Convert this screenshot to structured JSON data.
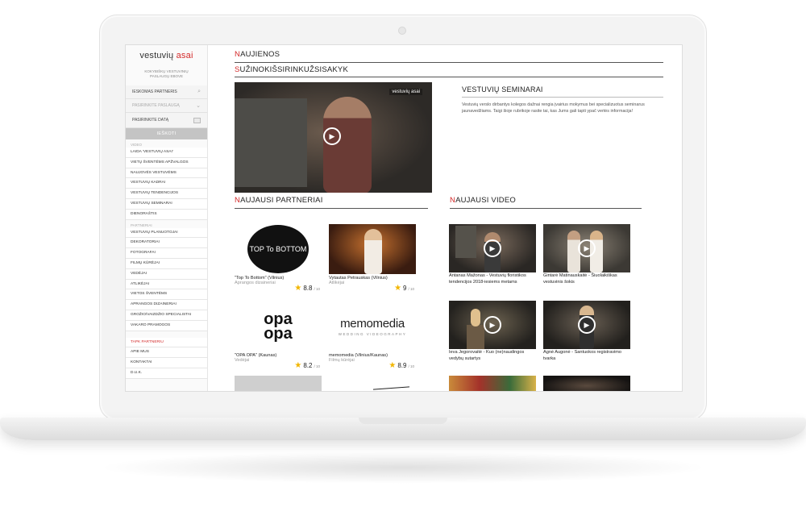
{
  "sidebar": {
    "logo_prefix": "vestuvių",
    "logo_suffix": "asai",
    "tagline": "KOKYBIŠKŲ VESTUVINIŲ PASLAUGŲ EBOVE",
    "search_partner": "IESKOMAS PARTNERIS",
    "select_service": "PASIRINKITE PASLAUGĄ",
    "select_date": "PASIRINKITE DATĄ",
    "search_button": "IEŠKOTI",
    "group_video": "VIDEO",
    "video_items": [
      "LAIDA 'VESTUVIŲ ASAI'",
      "VIETŲ ŠVENTĖMS APŽVALGOS",
      "NAUJOVĖS VESTUVĖMS",
      "VESTUVIŲ KADRAI",
      "VESTUVIŲ TENDENCIJOS",
      "VESTUVIŲ SEMINARAI",
      "DIENORAŠTIS"
    ],
    "group_partners": "PARTNERIAI",
    "partner_items": [
      "VESTUVIŲ PLANUOTOJAI",
      "DEKORATORIAI",
      "FOTOGRAFAI",
      "FILMŲ KŪRĖJAI",
      "VEDĖJAI",
      "ATLIKĖJAI",
      "VIETOS ŠVENTĖMS",
      "APRANGOS DIZAINERIAI",
      "GROŽIO/VAIZDŽIO SPECIALISTAI",
      "VAKARO PRAMOGOS"
    ],
    "footer_items": [
      "TAPK PARTNERIU",
      "APIE MUS",
      "KONTAKTAI",
      "D.U.K."
    ]
  },
  "main": {
    "news_title": "NAUJIENOS",
    "learn_title": "SUŽINOKIŠSIRINKUŽSISAKYK",
    "hero_watermark": "vestuvių asai",
    "seminars_title": "VESTUVIŲ SEMINARAI",
    "seminars_text": "Vestuvių verslo dirbantys kolegos dažnai rengia įvairius mokymus bei specializuotus seminarus jaunavedžiams. Taigi šioje rubrikoje rasite tai, kas Jums gali tapti ypač vertės informacija!",
    "partners_title": "NAUJAUSI PARTNERIAI",
    "videos_title": "NAUJAUSI VIDEO",
    "partners": [
      {
        "name": "\"Top To Bottom\" (Vilnius)",
        "category": "Aprangos dizaineriai",
        "rating": "8.8",
        "of": "/ 10",
        "logo": "TOP To BOTTOM"
      },
      {
        "name": "Vytautas Petrauskas (Vilnius)",
        "category": "Atlikėjai",
        "rating": "9",
        "of": "/ 10"
      },
      {
        "name": "\"OPA OPA\" (Kaunas)",
        "category": "Vedėjai",
        "rating": "8.2",
        "of": "/ 10",
        "logo": "opa opa"
      },
      {
        "name": "memomedia (Vilnius/Kaunas)",
        "category": "Filmų kūrėjai",
        "rating": "8.9",
        "of": "/ 10",
        "logo": "memomedia",
        "logo_sub": "WEDDING VIDEOGRAPHY"
      }
    ],
    "videos": [
      {
        "caption": "Antanas Mažonas - Vestuvių floristikos tendencijos 2018-iesiems metams"
      },
      {
        "caption": "Gintarė Matinauskaitė - Šiuolaikiškas vestuvinis šokis"
      },
      {
        "caption": "Ieva Jegorovaitė - Kuo (ne)naudingos vedybų sutartys"
      },
      {
        "caption": "Agnė Augonė - Santuokos registravimo tvarka"
      }
    ],
    "colors": {
      "accent": "#d32a2a",
      "star": "#f2b600"
    }
  }
}
